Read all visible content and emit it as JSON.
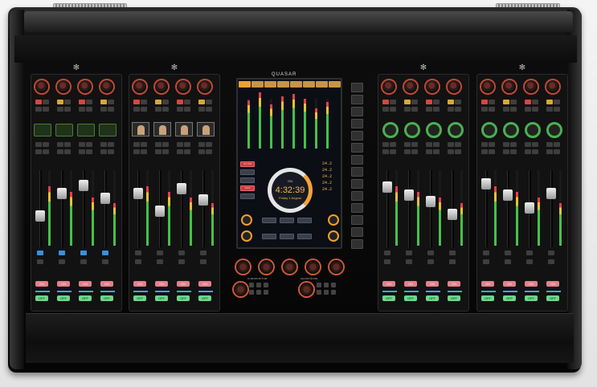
{
  "brand": {
    "name": "QUASAR"
  },
  "screen": {
    "tabs": [
      "",
      "",
      "",
      "",
      "",
      "",
      "",
      ""
    ],
    "clock": {
      "label": "ON",
      "time": "4:32:39",
      "date": "Friday 1 August"
    },
    "buttons": {
      "onair": "ON AIR",
      "talk": "TALK"
    }
  },
  "center": {
    "section_left": "CUE/MONITOR",
    "section_right": "HEADPHONE"
  },
  "strip": {
    "on_label": "ON",
    "off_label": "OFF"
  },
  "colors": {
    "knob_ring": "#c24a33",
    "on_button": "#e1818b",
    "off_button": "#6bd88b",
    "accent": "#f0a02e"
  },
  "icons": [
    "fan-icon",
    "knob-icon",
    "fader-icon",
    "clock-icon",
    "gauge-icon"
  ]
}
